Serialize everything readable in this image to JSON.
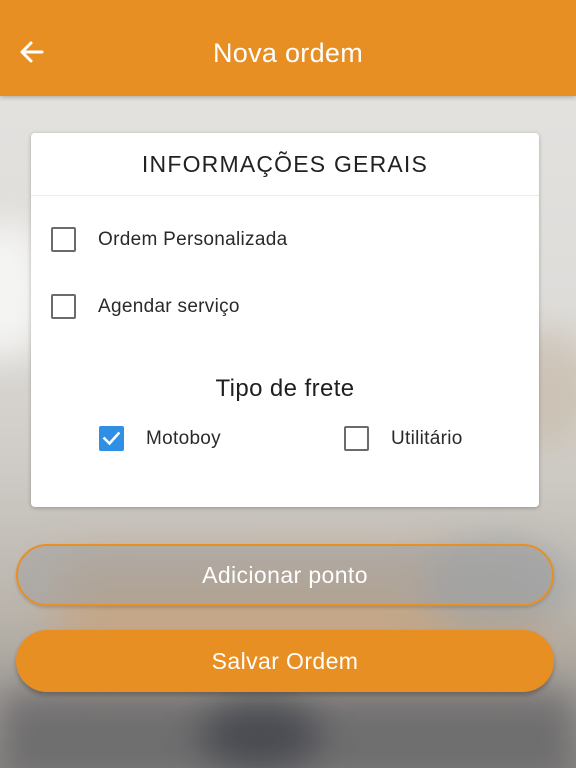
{
  "app_bar": {
    "title": "Nova ordem",
    "back_icon": "arrow-left-icon",
    "color": "#E88F24"
  },
  "general_info": {
    "heading": "INFORMAÇÕES GERAIS",
    "options": [
      {
        "label": "Ordem Personalizada",
        "checked": false
      },
      {
        "label": "Agendar serviço",
        "checked": false
      }
    ]
  },
  "freight": {
    "heading": "Tipo de frete",
    "options": [
      {
        "label": "Motoboy",
        "checked": true
      },
      {
        "label": "Utilitário",
        "checked": false
      }
    ],
    "checked_color": "#2E8FE5"
  },
  "actions": {
    "add_point_label": "Adicionar ponto",
    "save_label": "Salvar Ordem"
  }
}
